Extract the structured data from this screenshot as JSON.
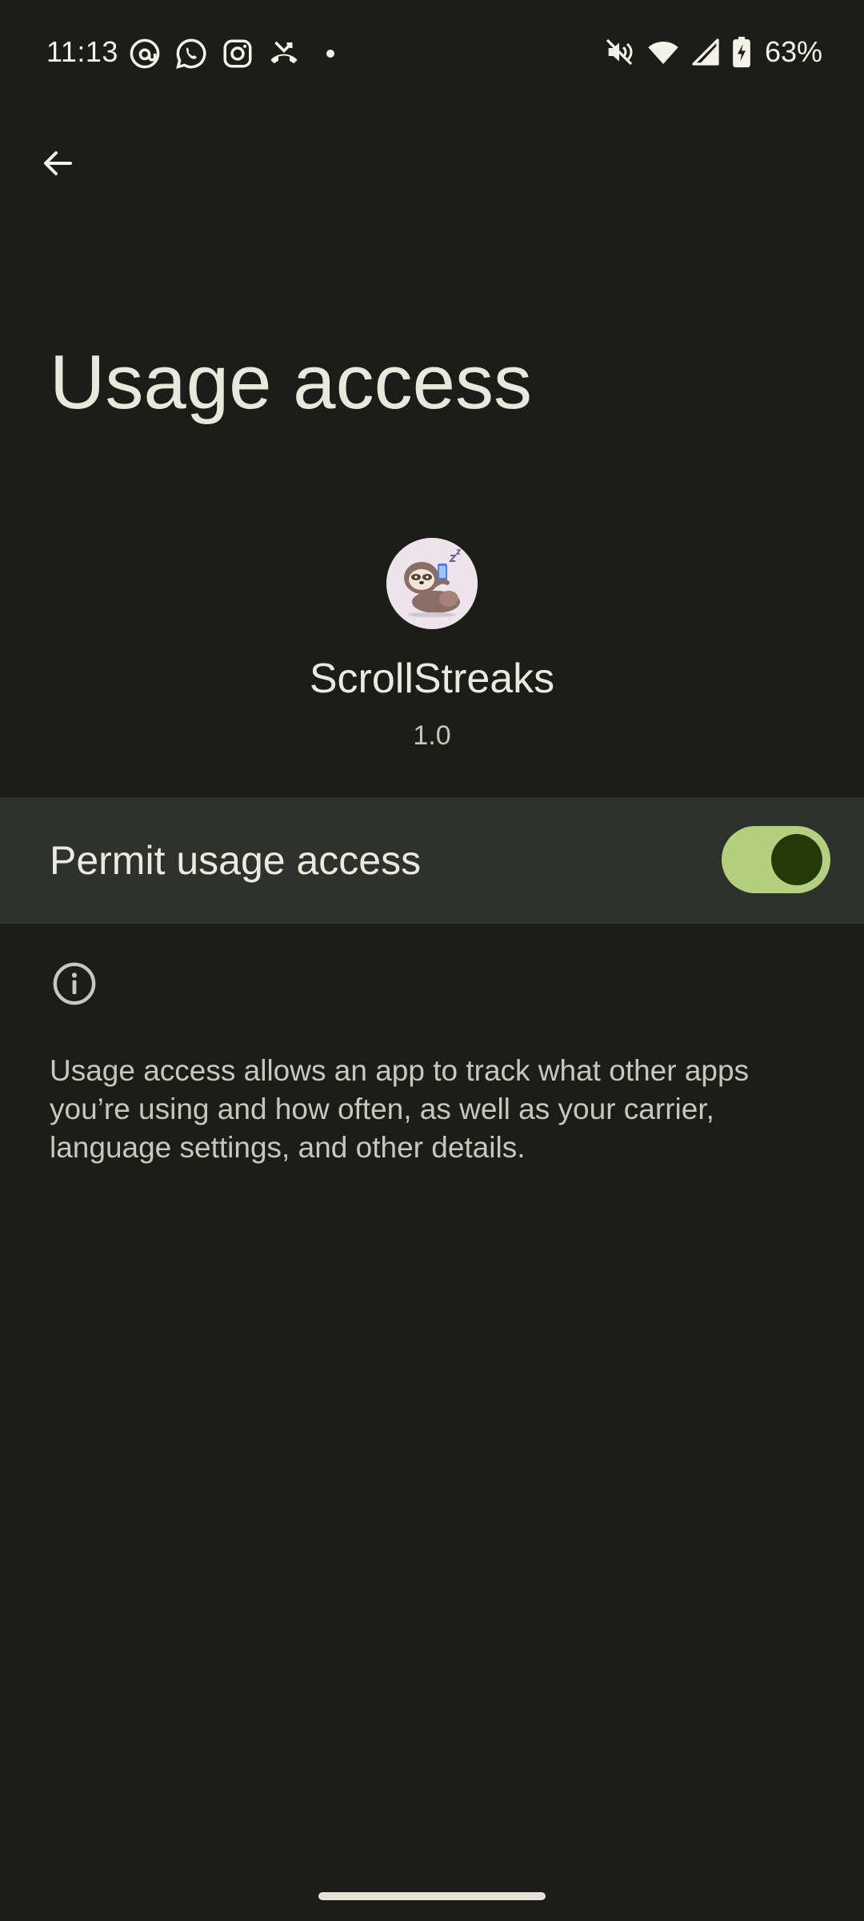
{
  "status_bar": {
    "time": "11:13",
    "notification_icons": [
      "threads-icon",
      "whatsapp-icon",
      "instagram-icon",
      "missed-call-icon",
      "more-notifications-dot"
    ],
    "system_icons": [
      "mute-icon",
      "wifi-icon",
      "signal-icon",
      "battery-charging-icon"
    ],
    "battery_percent": "63%"
  },
  "toolbar": {
    "back_icon": "arrow-back-icon"
  },
  "page": {
    "title": "Usage access"
  },
  "app": {
    "name": "ScrollStreaks",
    "version": "1.0",
    "icon": "sloth-app-icon"
  },
  "permission": {
    "label": "Permit usage access",
    "enabled": true
  },
  "info": {
    "icon": "info-icon",
    "text": "Usage access allows an app to track what other apps you’re using and how often, as well as your carrier, language settings, and other details."
  },
  "colors": {
    "background": "#1c1d19",
    "row_background": "#2f312c",
    "toggle_track": "#b5cf81",
    "toggle_knob": "#24380a"
  }
}
